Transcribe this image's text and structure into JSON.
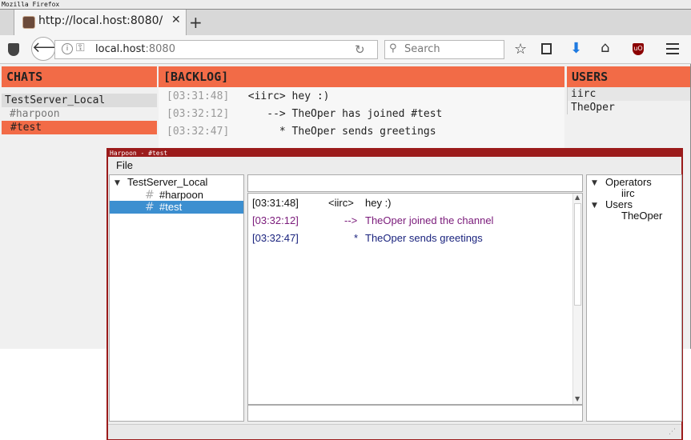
{
  "firefox": {
    "window_title": "Mozilla Firefox",
    "tab_title": "http://local.host:8080/",
    "tab_close": "✕",
    "new_tab": "+",
    "url_host": "local.host",
    "url_port": ":8080",
    "search_placeholder": "Search",
    "icons": [
      "shield-icon",
      "back-arrow-icon",
      "info-icon",
      "key-icon",
      "reload-icon",
      "search-icon",
      "bookmark-star-icon",
      "reader-icon",
      "download-icon",
      "home-icon",
      "ublock-icon",
      "hamburger-menu-icon"
    ]
  },
  "webapp": {
    "chats_header": "CHATS",
    "backlog_header": "[BACKLOG]",
    "users_header": "USERS",
    "chats": {
      "server": "TestServer_Local",
      "channels": [
        "#harpoon",
        "#test"
      ],
      "selected": "#test"
    },
    "backlog": [
      {
        "time": "[03:31:48]",
        "text": "   <iirc> hey :)"
      },
      {
        "time": "[03:32:12]",
        "text": "      --> TheOper has joined #test"
      },
      {
        "time": "[03:32:47]",
        "text": "        * TheOper sends greetings"
      }
    ],
    "users": [
      "iirc",
      "TheOper"
    ]
  },
  "harpoon": {
    "window_title": "Harpoon - #test",
    "menu_file": "File",
    "tree": {
      "server": "TestServer_Local",
      "channels": [
        "#harpoon",
        "#test"
      ],
      "selected": "#test",
      "channel_icon": "#"
    },
    "log": [
      {
        "time": "[03:31:48]",
        "nick": "<iirc>",
        "text": "hey :)"
      },
      {
        "time": "[03:32:12]",
        "marker": "-->",
        "text": "TheOper joined the channel"
      },
      {
        "time": "[03:32:47]",
        "marker": "*",
        "text": "TheOper sends greetings"
      }
    ],
    "nicklist": {
      "operators_label": "Operators",
      "operators": [
        "iirc"
      ],
      "users_label": "Users",
      "users": [
        "TheOper"
      ]
    },
    "colors": {
      "join": "#7a1a7a",
      "action": "#1a237e",
      "selection": "#3c8fd0",
      "frame": "#9b1b1b",
      "accent": "#f26b47"
    }
  }
}
